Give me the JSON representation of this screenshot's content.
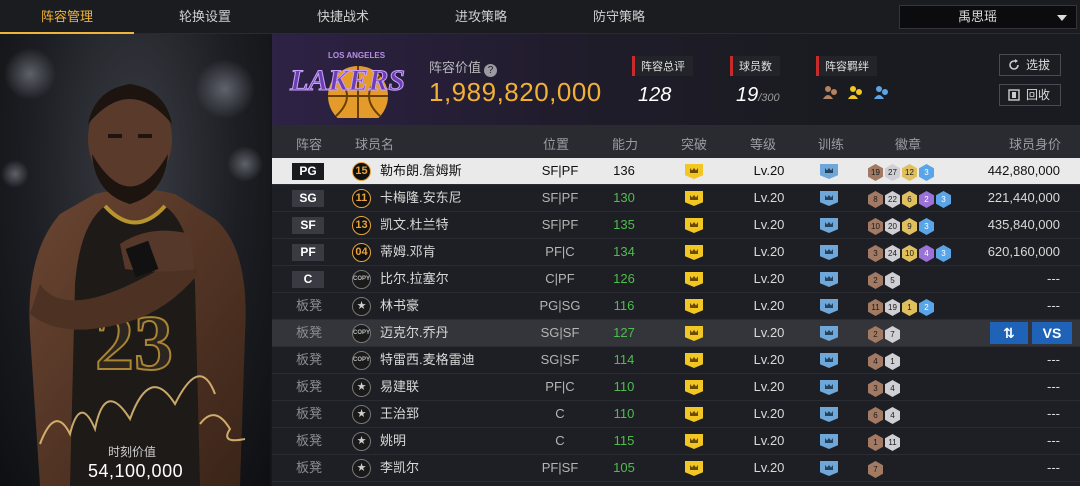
{
  "nav": {
    "tabs": [
      "阵容管理",
      "轮换设置",
      "快捷战术",
      "进攻策略",
      "防守策略"
    ],
    "active_tab": 0,
    "user": "禹思瑶"
  },
  "portrait": {
    "jersey_number": "23",
    "value_label": "时刻价值",
    "value": "54,100,000"
  },
  "team": {
    "logo_top_text": "LOS ANGELES",
    "logo_name": "LAKERS",
    "value_label": "阵容价值",
    "value": "1,989,820,000",
    "rating_label": "阵容总评",
    "rating": "128",
    "count_label": "球员数",
    "count": "19",
    "count_max": "/300",
    "bond_label": "阵容羁绊",
    "bond_icons": [
      "bond-bronze-icon",
      "bond-gold-icon",
      "bond-blue-icon"
    ],
    "btn_pick": "选拔",
    "btn_recycle": "回收"
  },
  "table": {
    "headers": [
      "阵容",
      "球员名",
      "位置",
      "能力",
      "突破",
      "等级",
      "训练",
      "徽章",
      "球员身价"
    ],
    "rows": [
      {
        "slot": "PG",
        "bench": false,
        "num": "15",
        "num_style": "gold",
        "name": "勒布朗.詹姆斯",
        "pos": "SF|PF",
        "ability": "136",
        "green": false,
        "level": "Lv.20",
        "badges": [
          [
            "19",
            "bronze"
          ],
          [
            "27",
            "silver"
          ],
          [
            "12",
            "gold"
          ],
          [
            "3",
            "blue"
          ]
        ],
        "salary": "442,880,000"
      },
      {
        "slot": "SG",
        "bench": false,
        "num": "11",
        "num_style": "gold",
        "name": "卡梅隆.安东尼",
        "pos": "SF|PF",
        "ability": "130",
        "green": true,
        "level": "Lv.20",
        "badges": [
          [
            "8",
            "bronze"
          ],
          [
            "22",
            "silver"
          ],
          [
            "6",
            "gold"
          ],
          [
            "2",
            "purple"
          ],
          [
            "3",
            "blue"
          ]
        ],
        "salary": "221,440,000"
      },
      {
        "slot": "SF",
        "bench": false,
        "num": "13",
        "num_style": "gold",
        "name": "凯文.杜兰特",
        "pos": "SF|PF",
        "ability": "135",
        "green": true,
        "level": "Lv.20",
        "badges": [
          [
            "10",
            "bronze"
          ],
          [
            "20",
            "silver"
          ],
          [
            "9",
            "gold"
          ],
          [
            "3",
            "blue"
          ]
        ],
        "salary": "435,840,000"
      },
      {
        "slot": "PF",
        "bench": false,
        "num": "04",
        "num_style": "gold",
        "name": "蒂姆.邓肯",
        "pos": "PF|C",
        "ability": "134",
        "green": true,
        "level": "Lv.20",
        "badges": [
          [
            "3",
            "bronze"
          ],
          [
            "24",
            "silver"
          ],
          [
            "10",
            "gold"
          ],
          [
            "4",
            "purple"
          ],
          [
            "3",
            "blue"
          ]
        ],
        "salary": "620,160,000"
      },
      {
        "slot": "C",
        "bench": false,
        "num": "COPY",
        "num_style": "copy",
        "name": "比尔.拉塞尔",
        "pos": "C|PF",
        "ability": "126",
        "green": true,
        "level": "Lv.20",
        "badges": [
          [
            "2",
            "bronze"
          ],
          [
            "5",
            "silver"
          ]
        ],
        "salary": "---"
      },
      {
        "slot": "板凳",
        "bench": true,
        "num": "★",
        "num_style": "star",
        "name": "林书豪",
        "pos": "PG|SG",
        "ability": "116",
        "green": true,
        "level": "Lv.20",
        "badges": [
          [
            "11",
            "bronze"
          ],
          [
            "19",
            "silver"
          ],
          [
            "1",
            "gold"
          ],
          [
            "2",
            "blue"
          ]
        ],
        "salary": "---"
      },
      {
        "slot": "板凳",
        "bench": true,
        "num": "COPY",
        "num_style": "copy",
        "name": "迈克尔.乔丹",
        "pos": "SG|SF",
        "ability": "127",
        "green": true,
        "level": "Lv.20",
        "badges": [
          [
            "2",
            "bronze"
          ],
          [
            "7",
            "silver"
          ]
        ],
        "salary": "",
        "actions": [
          "⇅",
          "VS"
        ]
      },
      {
        "slot": "板凳",
        "bench": true,
        "num": "COPY",
        "num_style": "copy",
        "name": "特雷西.麦格雷迪",
        "pos": "SG|SF",
        "ability": "114",
        "green": true,
        "level": "Lv.20",
        "badges": [
          [
            "4",
            "bronze"
          ],
          [
            "1",
            "silver"
          ]
        ],
        "salary": "---"
      },
      {
        "slot": "板凳",
        "bench": true,
        "num": "★",
        "num_style": "star",
        "name": "易建联",
        "pos": "PF|C",
        "ability": "110",
        "green": true,
        "level": "Lv.20",
        "badges": [
          [
            "3",
            "bronze"
          ],
          [
            "4",
            "silver"
          ]
        ],
        "salary": "---"
      },
      {
        "slot": "板凳",
        "bench": true,
        "num": "★",
        "num_style": "star",
        "name": "王治郅",
        "pos": "C",
        "ability": "110",
        "green": true,
        "level": "Lv.20",
        "badges": [
          [
            "6",
            "bronze"
          ],
          [
            "4",
            "silver"
          ]
        ],
        "salary": "---"
      },
      {
        "slot": "板凳",
        "bench": true,
        "num": "★",
        "num_style": "star",
        "name": "姚明",
        "pos": "C",
        "ability": "115",
        "green": true,
        "level": "Lv.20",
        "badges": [
          [
            "1",
            "bronze"
          ],
          [
            "11",
            "silver"
          ]
        ],
        "salary": "---"
      },
      {
        "slot": "板凳",
        "bench": true,
        "num": "★",
        "num_style": "star",
        "name": "李凯尔",
        "pos": "PF|SF",
        "ability": "105",
        "green": true,
        "level": "Lv.20",
        "badges": [
          [
            "7",
            "bronze"
          ]
        ],
        "salary": "---"
      }
    ]
  }
}
